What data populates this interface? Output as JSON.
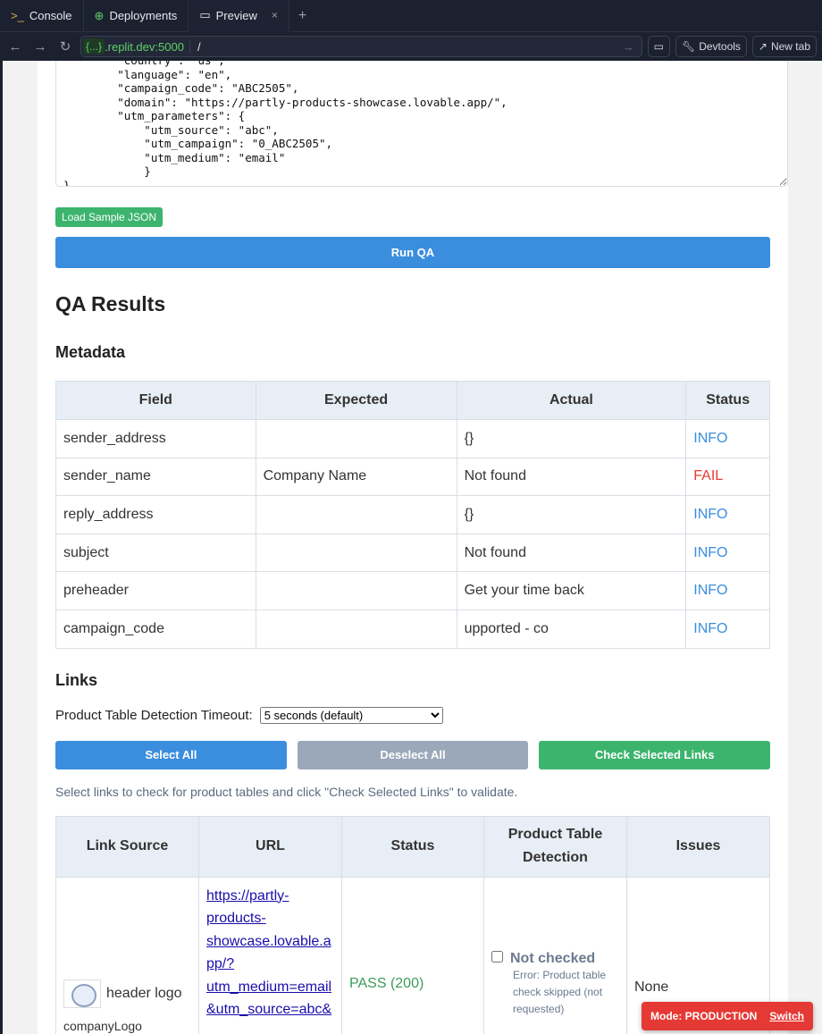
{
  "browser": {
    "tabs": [
      {
        "label": "Console",
        "icon": "terminal-icon"
      },
      {
        "label": "Deployments",
        "icon": "globe-icon"
      },
      {
        "label": "Preview",
        "icon": "monitor-icon"
      }
    ],
    "host_badge": "{...}",
    "domain": ".replit.dev:5000",
    "path": "/",
    "devtools": "Devtools",
    "new_tab": "New tab"
  },
  "json_input": "        \"country\": \"us\",\n        \"language\": \"en\",\n        \"campaign_code\": \"ABC2505\",\n        \"domain\": \"https://partly-products-showcase.lovable.app/\",\n        \"utm_parameters\": {\n            \"utm_source\": \"abc\",\n            \"utm_campaign\": \"0_ABC2505\",\n            \"utm_medium\": \"email\"\n            }\n}",
  "load_sample": "Load Sample JSON",
  "run_qa": "Run QA",
  "results_title": "QA Results",
  "metadata": {
    "title": "Metadata",
    "headers": [
      "Field",
      "Expected",
      "Actual",
      "Status"
    ],
    "rows": [
      [
        "sender_address",
        "",
        "{}",
        "INFO"
      ],
      [
        "sender_name",
        "Company Name",
        "Not found",
        "FAIL"
      ],
      [
        "reply_address",
        "",
        "{}",
        "INFO"
      ],
      [
        "subject",
        "",
        "Not found",
        "INFO"
      ],
      [
        "preheader",
        "",
        "Get your time back",
        "INFO"
      ],
      [
        "campaign_code",
        "",
        "upported - co",
        "INFO"
      ]
    ]
  },
  "links": {
    "title": "Links",
    "timeout_label": "Product Table Detection Timeout:",
    "timeout_value": "5 seconds (default)",
    "select_all": "Select All",
    "deselect_all": "Deselect All",
    "check_selected": "Check Selected Links",
    "hint": "Select links to check for product tables and click \"Check Selected Links\" to validate.",
    "headers": [
      "Link Source",
      "URL",
      "Status",
      "Product Table Detection",
      "Issues"
    ],
    "rows": [
      {
        "source": "header logo",
        "alt": "companyLogo",
        "url_lines": [
          "https://partly-",
          "products-",
          "showcase.lovable.a",
          "pp/?",
          "utm_medium=email",
          "&utm_source=abc&"
        ],
        "status": "PASS (200)",
        "detection": "Not checked",
        "detection_error": "Error: Product table check skipped (not requested)",
        "issues": "None"
      }
    ]
  },
  "mode": {
    "label": "Mode: PRODUCTION",
    "switch": "Switch"
  }
}
